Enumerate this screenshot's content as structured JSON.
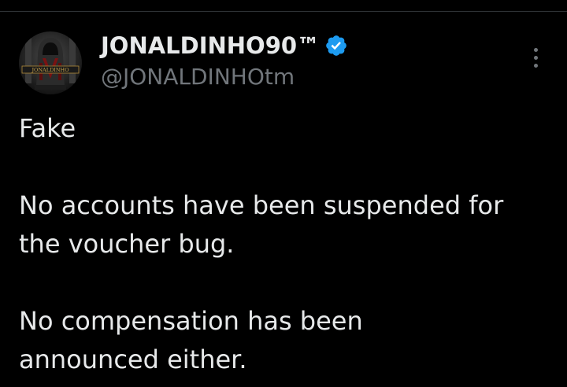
{
  "author": {
    "display_name": "JONALDINHO90™",
    "handle": "@JONALDINHOtm",
    "verified": true,
    "avatar_text": "JONALDINHO",
    "avatar_icon": "hooded-figure-avatar"
  },
  "tweet": {
    "lines": [
      "Fake",
      "",
      "No accounts have been suspended for",
      "the voucher bug.",
      "",
      "No compensation has been",
      "announced either."
    ]
  },
  "colors": {
    "background": "#000000",
    "text_primary": "#e7e9ea",
    "text_secondary": "#71767b",
    "verified_blue": "#1d9bf0",
    "divider": "#2f3336"
  },
  "icons": {
    "verified": "verified-badge-icon",
    "more": "more-options-icon"
  }
}
